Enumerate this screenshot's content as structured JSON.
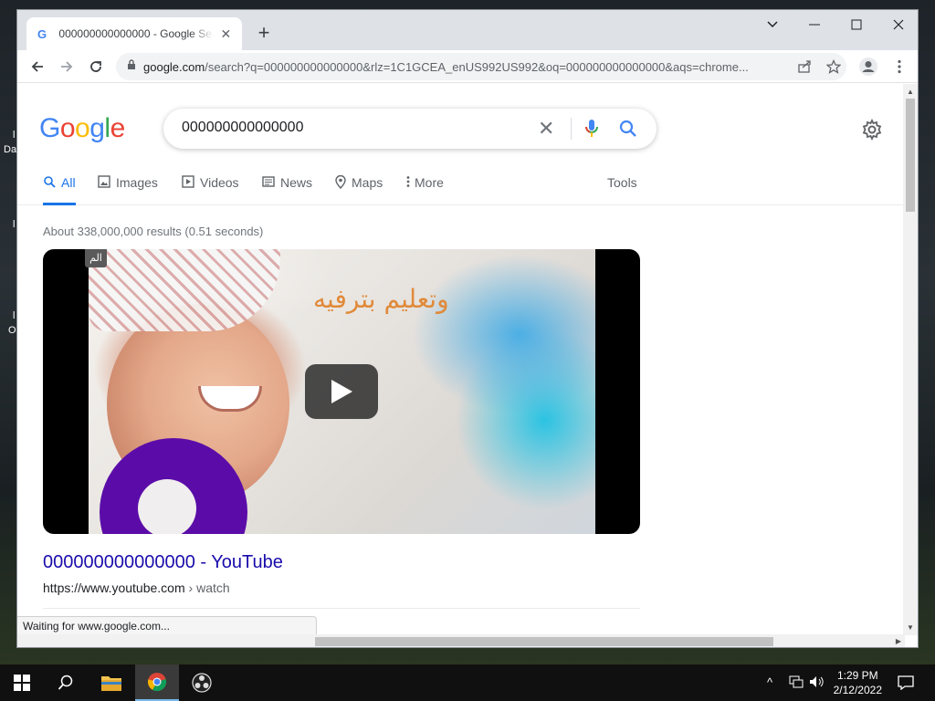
{
  "browser": {
    "tab_title": "000000000000000 - Google Search",
    "url_host": "google.com",
    "url_path": "/search?q=000000000000000&rlz=1C1GCEA_enUS992US992&oq=000000000000000&aqs=chrome...",
    "status_text": "Waiting for www.google.com..."
  },
  "search": {
    "logo_letters": [
      "G",
      "o",
      "o",
      "g",
      "l",
      "e"
    ],
    "logo_colors": [
      "#4285f4",
      "#ea4335",
      "#fbbc05",
      "#4285f4",
      "#34a853",
      "#ea4335"
    ],
    "query": "000000000000000",
    "tabs": [
      {
        "label": "All",
        "icon": "search-icon"
      },
      {
        "label": "Images",
        "icon": "image-icon"
      },
      {
        "label": "Videos",
        "icon": "video-icon"
      },
      {
        "label": "News",
        "icon": "news-icon"
      },
      {
        "label": "Maps",
        "icon": "map-pin-icon"
      },
      {
        "label": "More",
        "icon": "more-vert-icon"
      }
    ],
    "tools_label": "Tools",
    "stats": "About 338,000,000 results (0.51 seconds)"
  },
  "result": {
    "video_overlay_text": "وتعليم بترفيه",
    "video_chip": "الم",
    "title": "000000000000000 - YouTube",
    "url": "https://www.youtube.com",
    "breadcrumb": " › watch"
  },
  "taskbar": {
    "time": "1:29 PM",
    "date": "2/12/2022"
  },
  "colors": {
    "accent": "#1a73e8",
    "link": "#1a0dab"
  }
}
